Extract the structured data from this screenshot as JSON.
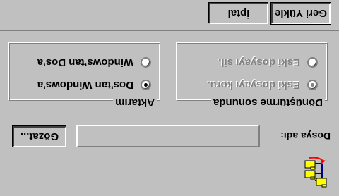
{
  "buttons": {
    "restore_label": "Geri Yükle",
    "cancel_label": "İptal",
    "browse_label": "Gözat..."
  },
  "file_name": {
    "label": "Dosya adı:",
    "value": ""
  },
  "conversion_group": {
    "title": "Dönüştürme sonunda",
    "options": [
      {
        "label": "Eski dosyayı koru.",
        "selected": true,
        "enabled": false
      },
      {
        "label": "Eski dosyayı sil.",
        "selected": false,
        "enabled": false
      }
    ]
  },
  "transfer_group": {
    "title": "Aktarım",
    "options": [
      {
        "label": "Dos'tan Windows'a",
        "selected": true,
        "enabled": true
      },
      {
        "label": "Windows'tan Dos'a",
        "selected": false,
        "enabled": true
      }
    ]
  },
  "icons": {
    "app_icon": "folder-tree-icon"
  },
  "colors": {
    "face": "#c0c0c0",
    "highlight": "#ffffff",
    "shadow": "#808080",
    "dark_shadow": "#404040",
    "folder_yellow": "#ffff00",
    "arrow_red": "#ff0000"
  }
}
